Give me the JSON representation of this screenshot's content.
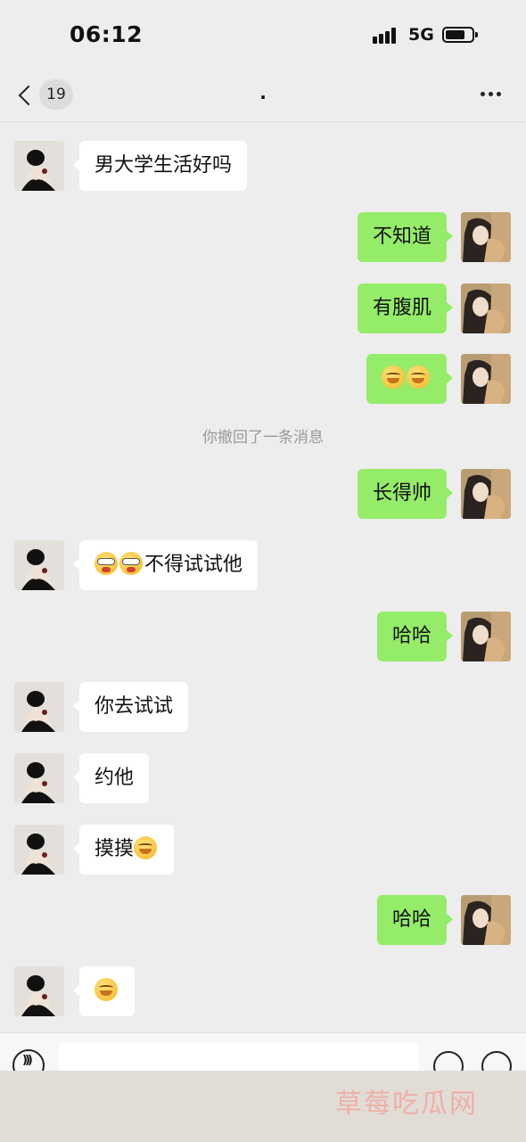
{
  "status_bar": {
    "time": "06:12",
    "network": "5G",
    "battery_level": 0.75
  },
  "header": {
    "unread_count": "19",
    "title": "."
  },
  "messages": [
    {
      "side": "left",
      "text": "男大学生活好吗"
    },
    {
      "side": "right",
      "text": "不知道"
    },
    {
      "side": "right",
      "text": "有腹肌"
    },
    {
      "side": "right",
      "text": "",
      "emojis": [
        "smirk-emoji",
        "smirk-emoji"
      ]
    },
    {
      "side": "right",
      "text": "长得帅"
    },
    {
      "side": "left",
      "text": "不得试试他",
      "emojis": [
        "dizzy-emoji",
        "dizzy-emoji"
      ]
    },
    {
      "side": "right",
      "text": "哈哈"
    },
    {
      "side": "left",
      "text": "你去试试"
    },
    {
      "side": "left",
      "text": "约他"
    },
    {
      "side": "left",
      "text": "摸摸",
      "emojis_after": [
        "smirk-emoji"
      ]
    },
    {
      "side": "right",
      "text": "哈哈"
    },
    {
      "side": "left",
      "text": "",
      "emojis": [
        "smirk-emoji"
      ]
    }
  ],
  "system_message": "你撤回了一条消息",
  "watermark": "草莓吃瓜网",
  "colors": {
    "background": "#ededed",
    "sent_bubble": "#95ec69",
    "received_bubble": "#ffffff",
    "system_text": "#9a9a9a"
  },
  "icons": {
    "back": "chevron-left-icon",
    "more": "more-dots-icon",
    "voice": "voice-icon",
    "emoji": "emoji-icon",
    "add": "plus-icon"
  }
}
